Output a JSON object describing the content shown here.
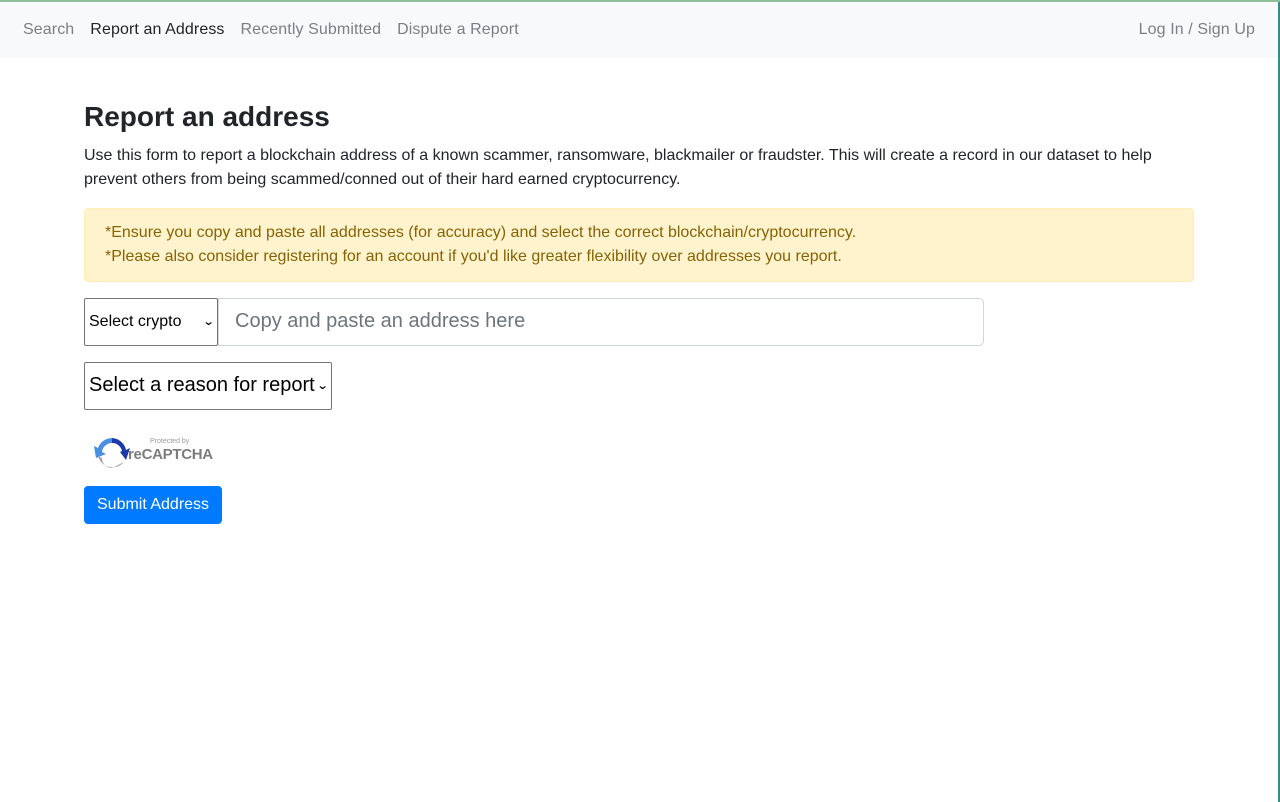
{
  "nav": {
    "links": [
      {
        "label": "Search",
        "active": false
      },
      {
        "label": "Report an Address",
        "active": true
      },
      {
        "label": "Recently Submitted",
        "active": false
      },
      {
        "label": "Dispute a Report",
        "active": false
      }
    ],
    "auth_label": "Log In / Sign Up"
  },
  "page": {
    "title": "Report an address",
    "description": "Use this form to report a blockchain address of a known scammer, ransomware, blackmailer or fraudster. This will create a record in our dataset to help prevent others from being scammed/conned out of their hard earned cryptocurrency."
  },
  "alert": {
    "lines": [
      "*Ensure you copy and paste all addresses (for accuracy) and select the correct blockchain/cryptocurrency.",
      "*Please also consider registering for an account if you'd like greater flexibility over addresses you report."
    ]
  },
  "form": {
    "crypto_select": {
      "selected": "Select crypto",
      "icon": "chevron-down-icon"
    },
    "address_input": {
      "value": "",
      "placeholder": "Copy and paste an address here"
    },
    "reason_select": {
      "selected": "Select a reason for report",
      "icon": "chevron-down-icon"
    },
    "recaptcha": {
      "small_text": "Protected by",
      "brand": "reCAPTCHA",
      "icon": "recaptcha-logo-icon"
    },
    "submit_label": "Submit Address"
  },
  "colors": {
    "primary": "#007bff",
    "alert_bg": "#fff3cd",
    "alert_text": "#856404",
    "navbar_bg": "#f8f9fa"
  }
}
